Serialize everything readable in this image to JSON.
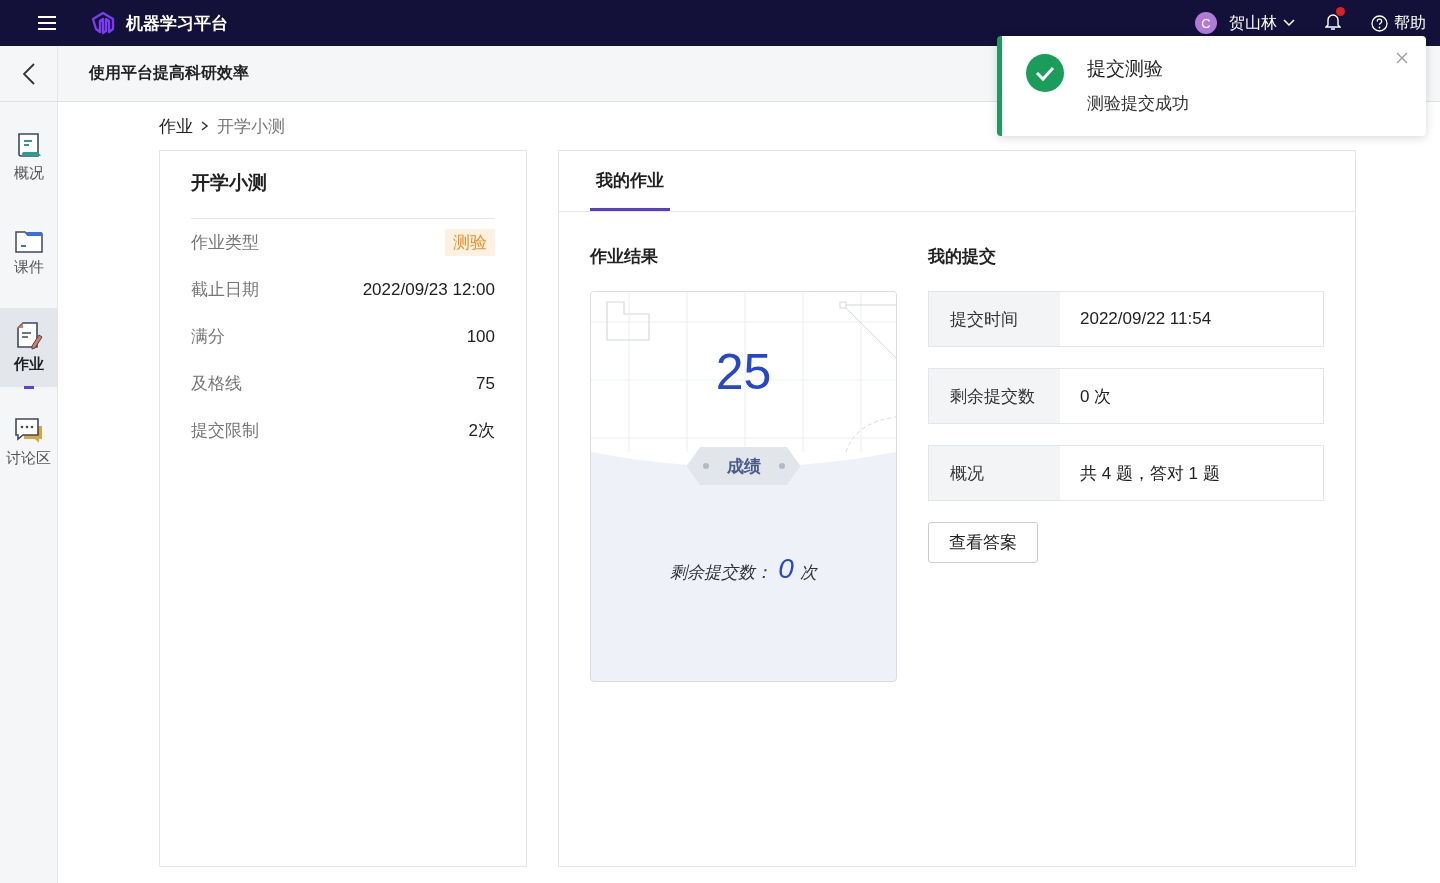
{
  "header": {
    "app_name": "机器学习平台",
    "user": {
      "avatar": "C",
      "name": "贺山林"
    },
    "notifications": {
      "unread": true
    },
    "help": "帮助"
  },
  "subheader": {
    "title": "使用平台提高科研效率"
  },
  "sidebar": {
    "items": [
      {
        "label": "概况",
        "selected": false
      },
      {
        "label": "课件",
        "selected": false
      },
      {
        "label": "作业",
        "selected": true
      },
      {
        "label": "讨论区",
        "selected": false
      }
    ]
  },
  "breadcrumb": [
    "作业",
    "开学小测"
  ],
  "assignment": {
    "title": "开学小测",
    "rows": [
      {
        "label": "作业类型",
        "value": "测验",
        "kind": "tag"
      },
      {
        "label": "截止日期",
        "value": "2022/09/23 12:00",
        "kind": "text"
      },
      {
        "label": "满分",
        "value": "100",
        "kind": "text"
      },
      {
        "label": "及格线",
        "value": "75",
        "kind": "text"
      },
      {
        "label": "提交限制",
        "value": "2次",
        "kind": "text"
      }
    ]
  },
  "panel": {
    "tabs": [
      {
        "label": "我的作业",
        "selected": true
      }
    ],
    "result": {
      "heading": "作业结果",
      "score": "25",
      "badge": "成绩",
      "remaining_label": "剩余提交数：",
      "remaining_value": "0",
      "remaining_unit": "次"
    },
    "submission": {
      "heading": "我的提交",
      "rows": [
        {
          "label": "提交时间",
          "value": "2022/09/22 11:54"
        },
        {
          "label": "剩余提交数",
          "value": "0 次"
        },
        {
          "label": "概况",
          "value": "共 4 题，答对 1 题"
        }
      ],
      "button": "查看答案"
    }
  },
  "toast": {
    "title": "提交测验",
    "message": "测验提交成功"
  }
}
